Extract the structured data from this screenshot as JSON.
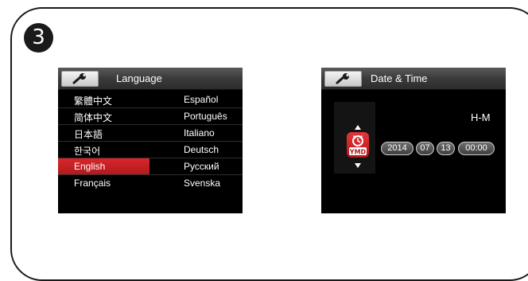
{
  "step": {
    "number": "3"
  },
  "language_screen": {
    "title": "Language",
    "rows": [
      {
        "left": "繁體中文",
        "right": "Español"
      },
      {
        "left": "简体中文",
        "right": "Português"
      },
      {
        "left": "日本語",
        "right": "Italiano"
      },
      {
        "left": "한국어",
        "right": "Deutsch"
      },
      {
        "left": "English",
        "right": "Русский"
      },
      {
        "left": "Français",
        "right": "Svenska"
      }
    ],
    "selected_label": "English",
    "selection_color": "#c8202a"
  },
  "date_time_screen": {
    "title": "Date & Time",
    "format": "H-M",
    "year": "2014",
    "month": "07",
    "day": "13",
    "time": "00:00",
    "icon_label": "YMD"
  },
  "icons": [
    "wrench-icon",
    "ymd-clock-icon",
    "arrow-up-icon",
    "arrow-down-icon"
  ]
}
